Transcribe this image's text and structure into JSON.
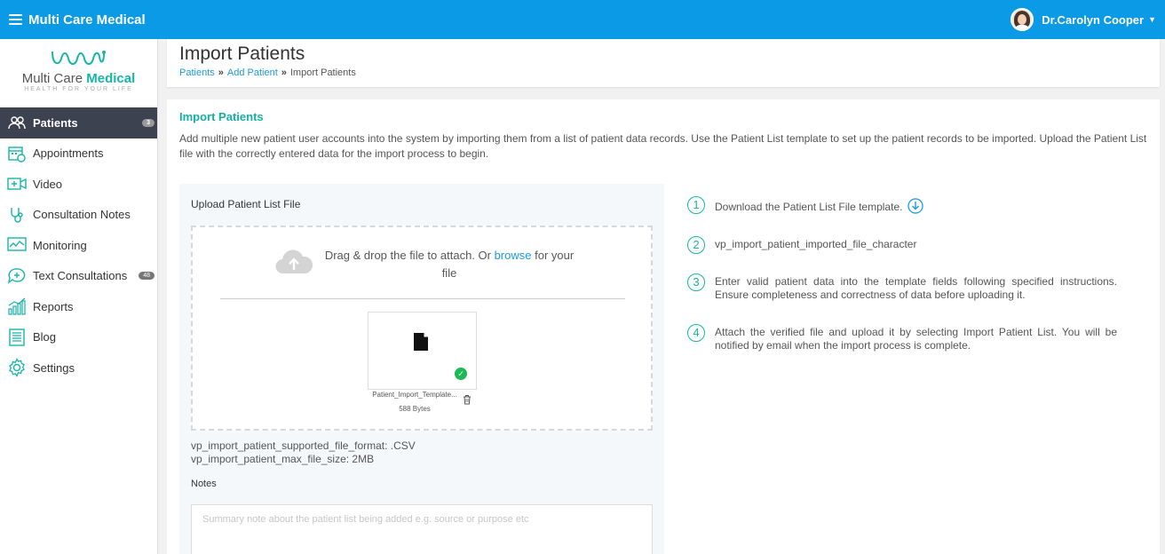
{
  "app": {
    "brand": "Multi Care Medical",
    "user_name": "Dr.Carolyn Cooper",
    "accent_color": "#0a9ae6",
    "teal_color": "#16b5a8"
  },
  "logo": {
    "text_plain": "Multi Care ",
    "text_bold": "Medical",
    "tagline": "HEALTH FOR YOUR LIFE"
  },
  "sidebar": {
    "items": [
      {
        "label": "Patients",
        "icon": "patients-icon",
        "badge": "3",
        "active": true
      },
      {
        "label": "Appointments",
        "icon": "calendar-icon"
      },
      {
        "label": "Video",
        "icon": "video-icon"
      },
      {
        "label": "Consultation Notes",
        "icon": "stethoscope-icon"
      },
      {
        "label": "Monitoring",
        "icon": "monitoring-icon"
      },
      {
        "label": "Text Consultations",
        "icon": "chat-icon",
        "badge": "48"
      },
      {
        "label": "Reports",
        "icon": "reports-icon"
      },
      {
        "label": "Blog",
        "icon": "blog-icon"
      },
      {
        "label": "Settings",
        "icon": "gear-icon"
      }
    ]
  },
  "header": {
    "title": "Import Patients",
    "breadcrumb": [
      "Patients",
      "Add Patient",
      "Import Patients"
    ]
  },
  "main": {
    "section_title": "Import Patients",
    "intro": "Add multiple new patient user accounts into the system by importing them from a list of patient data records. Use the Patient List template to set up the patient records to be imported. Upload the Patient List file with the correctly entered data for the import process to begin.",
    "upload": {
      "label": "Upload Patient List File",
      "drop_prefix": "Drag & drop the file to attach. Or ",
      "browse": "browse",
      "drop_suffix": " for your file",
      "file_name": "Patient_Import_Template...",
      "file_size": "588 Bytes",
      "supported_format": "vp_import_patient_supported_file_format: .CSV",
      "max_size": "vp_import_patient_max_file_size: 2MB",
      "notes_label": "Notes",
      "notes_placeholder": "Summary note about the patient list being added e.g. source or purpose etc",
      "notes_value": ""
    },
    "steps": [
      {
        "num": "1",
        "text": "Download the Patient List File template."
      },
      {
        "num": "2",
        "text": "vp_import_patient_imported_file_character"
      },
      {
        "num": "3",
        "text": "Enter valid patient data into the template fields following specified instructions. Ensure completeness and correctness of data before uploading it."
      },
      {
        "num": "4",
        "text": "Attach the verified file and upload it by selecting Import Patient List. You will be notified by email when the import process is complete."
      }
    ]
  }
}
